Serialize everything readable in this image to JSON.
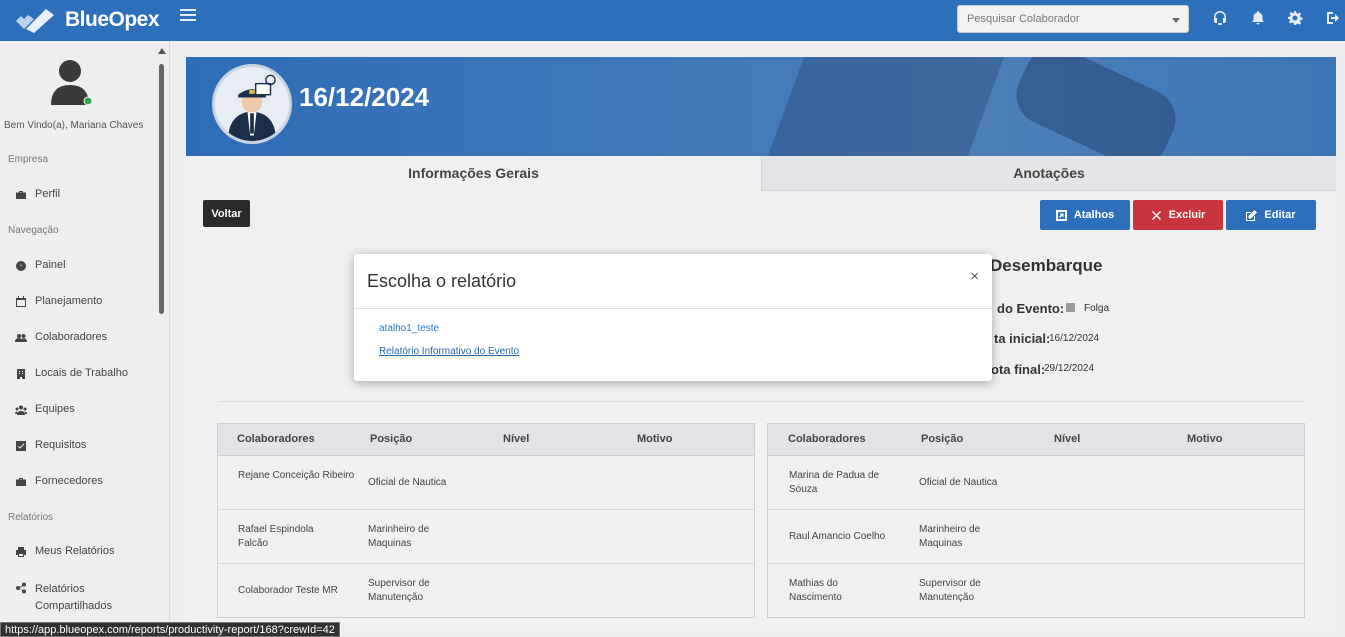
{
  "app": {
    "name": "BlueOpex"
  },
  "topbar": {
    "search_placeholder": "Pesquisar Colaborador",
    "icons": [
      "headset-icon",
      "bell-icon",
      "gear-icon",
      "logout-icon"
    ]
  },
  "sidebar": {
    "welcome": "Bem Vindo(a), Mariana Chaves",
    "sections": {
      "empresa": "Empresa",
      "navegacao": "Navegação",
      "relatorios": "Relatórios"
    },
    "items": {
      "perfil": "Perfil",
      "painel": "Painel",
      "planejamento": "Planejamento",
      "colaboradores": "Colaboradores",
      "locais": "Locais de Trabalho",
      "equipes": "Equipes",
      "requisitos": "Requisitos",
      "fornecedores": "Fornecedores",
      "meus_relatorios": "Meus Relatórios",
      "relatorios_compartilhados": "Relatórios Compartilhados"
    }
  },
  "event": {
    "date_title": "16/12/2024",
    "tabs": {
      "general": "Informações Gerais",
      "notes": "Anotações"
    },
    "buttons": {
      "back": "Voltar",
      "shortcuts": "Atalhos",
      "delete": "Excluir",
      "edit": "Editar"
    },
    "details": {
      "title": "Desembarque",
      "type_label": "do Evento:",
      "type_value": "Folga",
      "start_label": "ta inicial:",
      "start_value": "16/12/2024",
      "end_label": "ota final:",
      "end_value": "29/12/2024"
    },
    "colors": {
      "primary": "#2d6fbb",
      "danger": "#c9353c",
      "dark": "#2a2a2a"
    }
  },
  "table_headers": {
    "colaboradores": "Colaboradores",
    "posicao": "Posição",
    "nivel": "Nível",
    "motivo": "Motivo"
  },
  "left_table": {
    "rows": [
      {
        "name": "Rejane Conceição Ribeiro",
        "position": "Oficial de Nautica"
      },
      {
        "name": "Rafael Espindola Falcão",
        "position": "Marinheiro de Maquinas"
      },
      {
        "name": "Colaborador Teste MR",
        "position": "Supervisor de Manutenção"
      }
    ]
  },
  "right_table": {
    "rows": [
      {
        "name": "Marina de Padua de Souza",
        "position": "Oficial de Nautica"
      },
      {
        "name": "Raul Amancio Coelho",
        "position": "Marinheiro de Maquinas"
      },
      {
        "name": "Mathias do Nascimento",
        "position": "Supervisor de Manutenção"
      }
    ]
  },
  "modal": {
    "title": "Escolha o relatório",
    "close": "×",
    "links": [
      "atalho1_teste",
      "Relatório Informativo do Evento"
    ]
  },
  "statusbar": {
    "url": "https://app.blueopex.com/reports/productivity-report/168?crewId=42"
  }
}
